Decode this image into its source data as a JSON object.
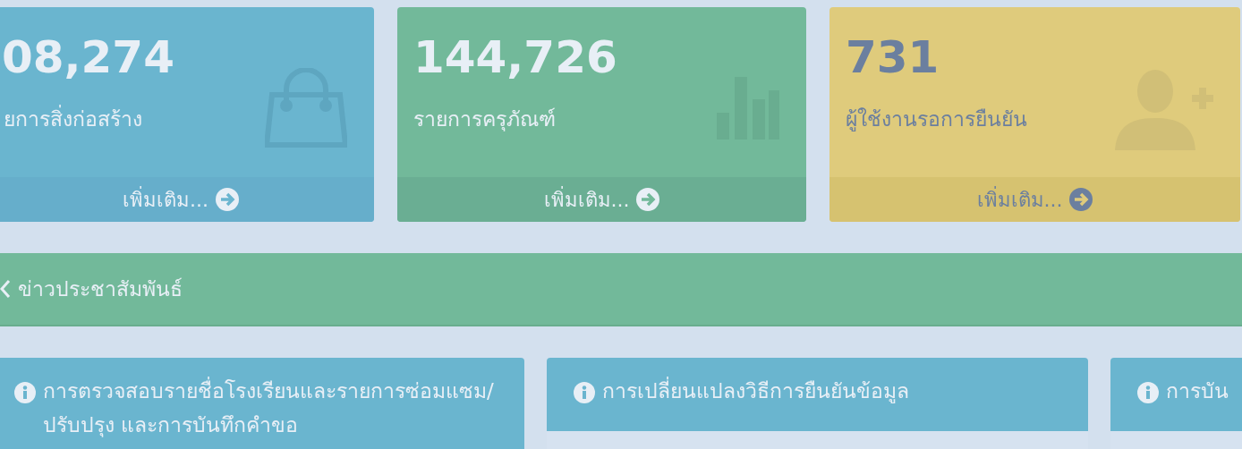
{
  "stat_cards": [
    {
      "kind": "bag",
      "color": "#6ab5cf",
      "value": "08,274",
      "label": "ยการสิ่งก่อสร้าง",
      "link": "เพิ่มเติม..."
    },
    {
      "kind": "chart",
      "color": "#72b99a",
      "value": "144,726",
      "label": "รายการครุภัณฑ์",
      "link": "เพิ่มเติม..."
    },
    {
      "kind": "user",
      "color": "#dfcb7c",
      "value": "731",
      "label": "ผู้ใช้งานรอการยืนยัน",
      "link": "เพิ่มเติม..."
    }
  ],
  "banner": {
    "title": "ข่าวประชาสัมพันธ์"
  },
  "panels": [
    {
      "title": "การตรวจสอบรายชื่อโรงเรียนและรายการซ่อมแซม/ปรับปรุง และการบันทึกคำขอ"
    },
    {
      "title": "การเปลี่ยนแปลงวิธีการยืนยันข้อมูล"
    },
    {
      "title": "การบัน"
    }
  ]
}
